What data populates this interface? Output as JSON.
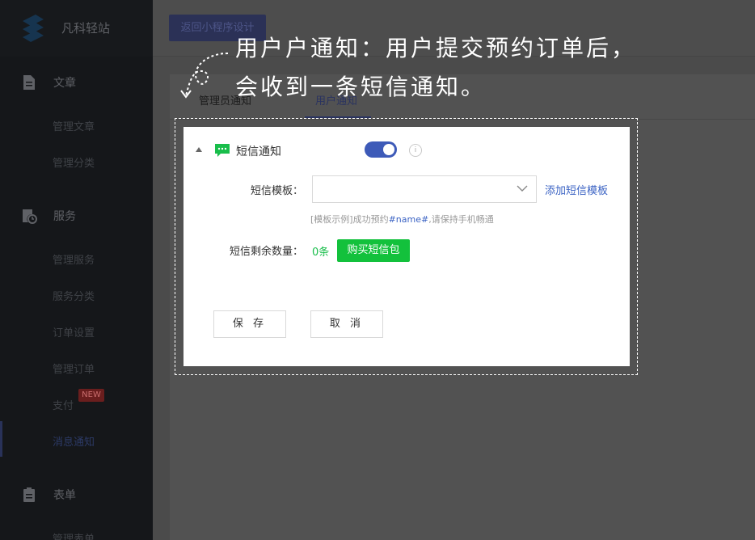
{
  "brand": {
    "name": "凡科轻站"
  },
  "sidebar": {
    "sections": [
      {
        "label": "文章",
        "items": [
          "管理文章",
          "管理分类"
        ]
      },
      {
        "label": "服务",
        "items": [
          "管理服务",
          "服务分类",
          "订单设置",
          "管理订单",
          "支付",
          "消息通知"
        ]
      },
      {
        "label": "表单",
        "items": [
          "管理表单"
        ]
      }
    ],
    "badge_new": "NEW",
    "active_item": "消息通知"
  },
  "topbar": {
    "back_label": "返回小程序设计"
  },
  "tabs": [
    {
      "label": "管理员通知",
      "active": false
    },
    {
      "label": "用户通知",
      "active": true
    }
  ],
  "annotation": {
    "line1": "用户户通知：用户提交预约订单后，",
    "line2": "会收到一条短信通知。"
  },
  "panel": {
    "title": "短信通知",
    "toggle_on": true,
    "info_label": "i",
    "template_label": "短信模板：",
    "template_value": "",
    "add_template_link": "添加短信模板",
    "hint_prefix": "[模板示例]成功预约",
    "hint_var": "#name#",
    "hint_suffix": ",请保持手机畅通",
    "remaining_label": "短信剩余数量：",
    "remaining_count": "0条",
    "buy_label": "购买短信包",
    "save_label": "保 存",
    "cancel_label": "取 消"
  },
  "colors": {
    "accent": "#3b63c4",
    "success": "#13c13c",
    "toggle": "#3d5ab8"
  }
}
